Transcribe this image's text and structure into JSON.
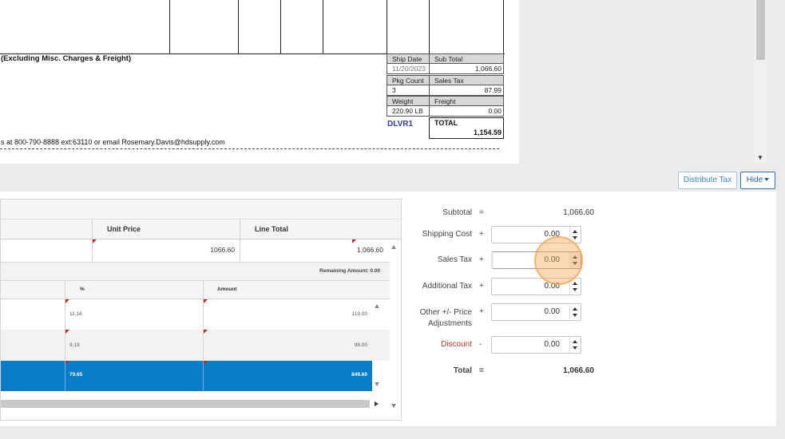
{
  "document": {
    "excluding_note": "(Excluding Misc. Charges & Freight)",
    "contact_line": "s at 800-790-8888 ext:63110 or email Rosemary.Davis@hdsupply.com",
    "ship_date_label": "Ship Date",
    "ship_date_value": "11/20/2023",
    "sub_total_label": "Sub Total",
    "sub_total_value": "1,066.60",
    "pkg_count_label": "Pkg Count",
    "pkg_count_value": "3",
    "sales_tax_label": "Sales Tax",
    "sales_tax_value": "87.99",
    "weight_label": "Weight",
    "weight_value": "220.90 LB",
    "freight_label": "Freight",
    "freight_value": "0.00",
    "carrier_code": "DLVR1",
    "total_label": "TOTAL",
    "total_value": "1,154.59"
  },
  "toolbar": {
    "distribute_tax": "Distribute Tax",
    "hide": "Hide"
  },
  "line_grid": {
    "col_unit_price": "Unit Price",
    "col_line_total": "Line Total",
    "row_unit_price": "1066.60",
    "row_line_total": "1,066.60",
    "remaining_amount": "Remaining Amount: 0.00",
    "col_percent": "%",
    "col_amount": "Amount",
    "alloc_rows": [
      {
        "percent": "11.16",
        "amount": "119.00",
        "selected": false
      },
      {
        "percent": "9.19",
        "amount": "98.00",
        "selected": false
      },
      {
        "percent": "79.65",
        "amount": "849.60",
        "selected": true
      }
    ]
  },
  "summary": {
    "subtotal_label": "Subtotal",
    "subtotal_op": "=",
    "subtotal_value": "1,066.60",
    "shipping_label": "Shipping Cost",
    "shipping_op": "+",
    "shipping_value": "0.00",
    "sales_tax_label": "Sales Tax",
    "sales_tax_op": "+",
    "sales_tax_value": "0.00",
    "additional_tax_label": "Additional Tax",
    "additional_tax_op": "+",
    "additional_tax_value": "0.00",
    "other_label_1": "Other +/- Price",
    "other_label_2": "Adjustments",
    "other_op": "+",
    "other_value": "0.00",
    "discount_label": "Discount",
    "discount_op": "-",
    "discount_value": "0.00",
    "total_label": "Total",
    "total_op": "=",
    "total_value": "1,066.60"
  },
  "colors": {
    "selected_row": "#0a7cc8",
    "discount_label": "#c0392b",
    "carrier_code": "#3040a8"
  }
}
